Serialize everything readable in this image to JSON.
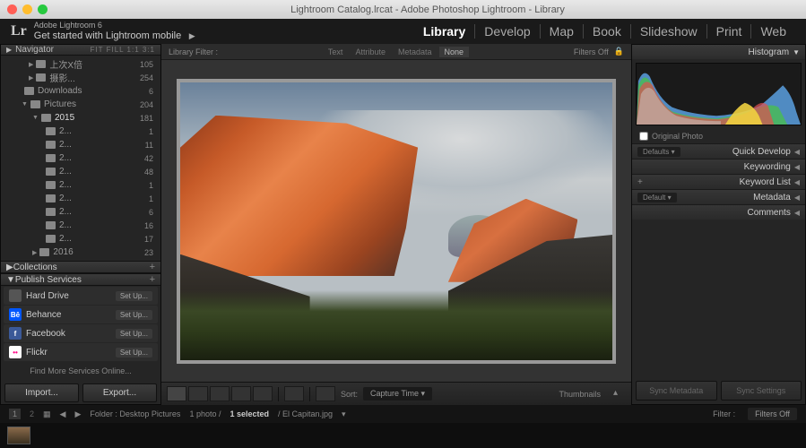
{
  "window": {
    "title": "Lightroom Catalog.lrcat - Adobe Photoshop Lightroom - Library"
  },
  "identity": {
    "logo": "Lr",
    "product": "Adobe Lightroom 6",
    "tagline": "Get started with Lightroom mobile"
  },
  "modules": {
    "library": "Library",
    "develop": "Develop",
    "map": "Map",
    "book": "Book",
    "slideshow": "Slideshow",
    "print": "Print",
    "web": "Web",
    "active": "library"
  },
  "navigator": {
    "title": "Navigator",
    "viewopts": "FIT  FILL  1:1  3:1"
  },
  "folders": [
    {
      "indent": 28,
      "name": "上次X倍",
      "count": 105,
      "tri": "▶"
    },
    {
      "indent": 28,
      "name": "摄影...",
      "count": 254,
      "tri": "▶"
    },
    {
      "indent": 20,
      "name": "Downloads",
      "count": 6,
      "tri": ""
    },
    {
      "indent": 20,
      "name": "Pictures",
      "count": 204,
      "tri": "▼"
    },
    {
      "indent": 32,
      "name": "2015",
      "count": 181,
      "tri": "▼",
      "sel": true
    },
    {
      "indent": 44,
      "name": "2...",
      "count": 1
    },
    {
      "indent": 44,
      "name": "2...",
      "count": 11
    },
    {
      "indent": 44,
      "name": "2...",
      "count": 42
    },
    {
      "indent": 44,
      "name": "2...",
      "count": 48
    },
    {
      "indent": 44,
      "name": "2...",
      "count": 1
    },
    {
      "indent": 44,
      "name": "2...",
      "count": 1
    },
    {
      "indent": 44,
      "name": "2...",
      "count": 6
    },
    {
      "indent": 44,
      "name": "2...",
      "count": 16
    },
    {
      "indent": 44,
      "name": "2...",
      "count": 17
    },
    {
      "indent": 32,
      "name": "2016",
      "count": 23,
      "tri": "▶"
    }
  ],
  "collections": {
    "title": "Collections"
  },
  "publish": {
    "title": "Publish Services",
    "items": [
      {
        "name": "Hard Drive",
        "icon_bg": "#555",
        "icon_txt": "",
        "setup": "Set Up..."
      },
      {
        "name": "Behance",
        "icon_bg": "#0057ff",
        "icon_txt": "Bē",
        "icon_color": "#fff",
        "setup": "Set Up..."
      },
      {
        "name": "Facebook",
        "icon_bg": "#3b5998",
        "icon_txt": "f",
        "icon_color": "#fff",
        "setup": "Set Up..."
      },
      {
        "name": "Flickr",
        "icon_bg": "#fff",
        "icon_txt": "••",
        "icon_color": "#ff0084",
        "setup": "Set Up..."
      }
    ],
    "findmore": "Find More Services Online..."
  },
  "buttons": {
    "import": "Import...",
    "export": "Export..."
  },
  "filter": {
    "label": "Library Filter :",
    "tabs": {
      "text": "Text",
      "attribute": "Attribute",
      "metadata": "Metadata",
      "none": "None"
    },
    "status": "Filters Off"
  },
  "toolbar": {
    "sort_label": "Sort:",
    "sort_value": "Capture Time",
    "thumbnails": "Thumbnails"
  },
  "right": {
    "histogram": "Histogram",
    "original": "Original Photo",
    "defaults": "Defaults",
    "default": "Default",
    "sections": {
      "quickdev": "Quick Develop",
      "keywording": "Keywording",
      "keywordlist": "Keyword List",
      "metadata": "Metadata",
      "comments": "Comments"
    },
    "sync_meta": "Sync Metadata",
    "sync_settings": "Sync Settings"
  },
  "status": {
    "folder": "Folder : Desktop Pictures",
    "count": "1 photo /",
    "selected": "1 selected",
    "filename": "/ El Capitan.jpg",
    "filter_label": "Filter :",
    "filter_value": "Filters Off"
  }
}
